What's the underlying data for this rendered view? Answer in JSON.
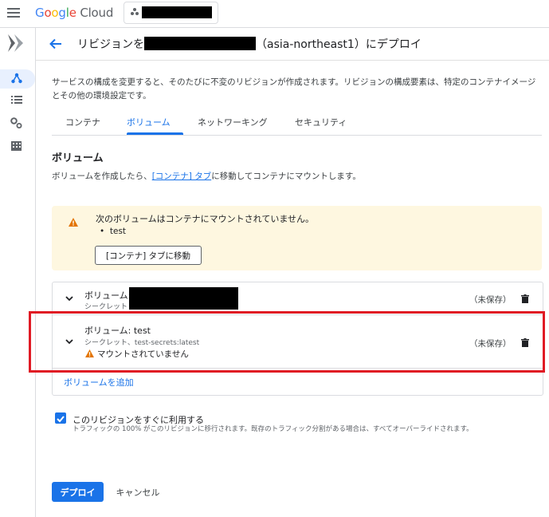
{
  "topbar": {
    "logo_google": [
      "G",
      "o",
      "o",
      "g",
      "l",
      "e"
    ],
    "logo_cloud": "Cloud"
  },
  "header": {
    "title_prefix": "リビジョンを",
    "title_suffix": "（asia-northeast1）にデプロイ"
  },
  "description": "サービスの構成を変更すると、そのたびに不変のリビジョンが作成されます。リビジョンの構成要素は、特定のコンテナイメージとその他の環境設定です。",
  "tabs": [
    {
      "label": "コンテナ"
    },
    {
      "label": "ボリューム"
    },
    {
      "label": "ネットワーキング"
    },
    {
      "label": "セキュリティ"
    }
  ],
  "volumes_section": {
    "heading": "ボリューム",
    "desc_before": "ボリュームを作成したら、",
    "desc_link": "[コンテナ] タブ",
    "desc_after": "に移動してコンテナにマウントします。",
    "warning": {
      "text": "次のボリュームはコンテナにマウントされていません。",
      "items": [
        "test"
      ],
      "button": "[コンテナ] タブに移動"
    },
    "list": [
      {
        "name": "ボリューム:",
        "subtitle": "シークレット",
        "status": "（未保存）"
      },
      {
        "name": "ボリューム: test",
        "subtitle": "シークレット、test-secrets:latest",
        "warning": "マウントされていません",
        "status": "（未保存）"
      }
    ],
    "add_label": "ボリュームを追加"
  },
  "serve_checkbox": {
    "checked": true,
    "label": "このリビジョンをすぐに利用する",
    "sublabel": "トラフィックの 100% がこのリビジョンに移行されます。既存のトラフィック分割がある場合は、すべてオーバーライドされます。"
  },
  "actions": {
    "deploy": "デプロイ",
    "cancel": "キャンセル"
  },
  "colors": {
    "accent": "#1a73e8",
    "warning_bg": "#fef7e0",
    "warning_icon": "#e37400",
    "highlight": "#e01a24"
  }
}
